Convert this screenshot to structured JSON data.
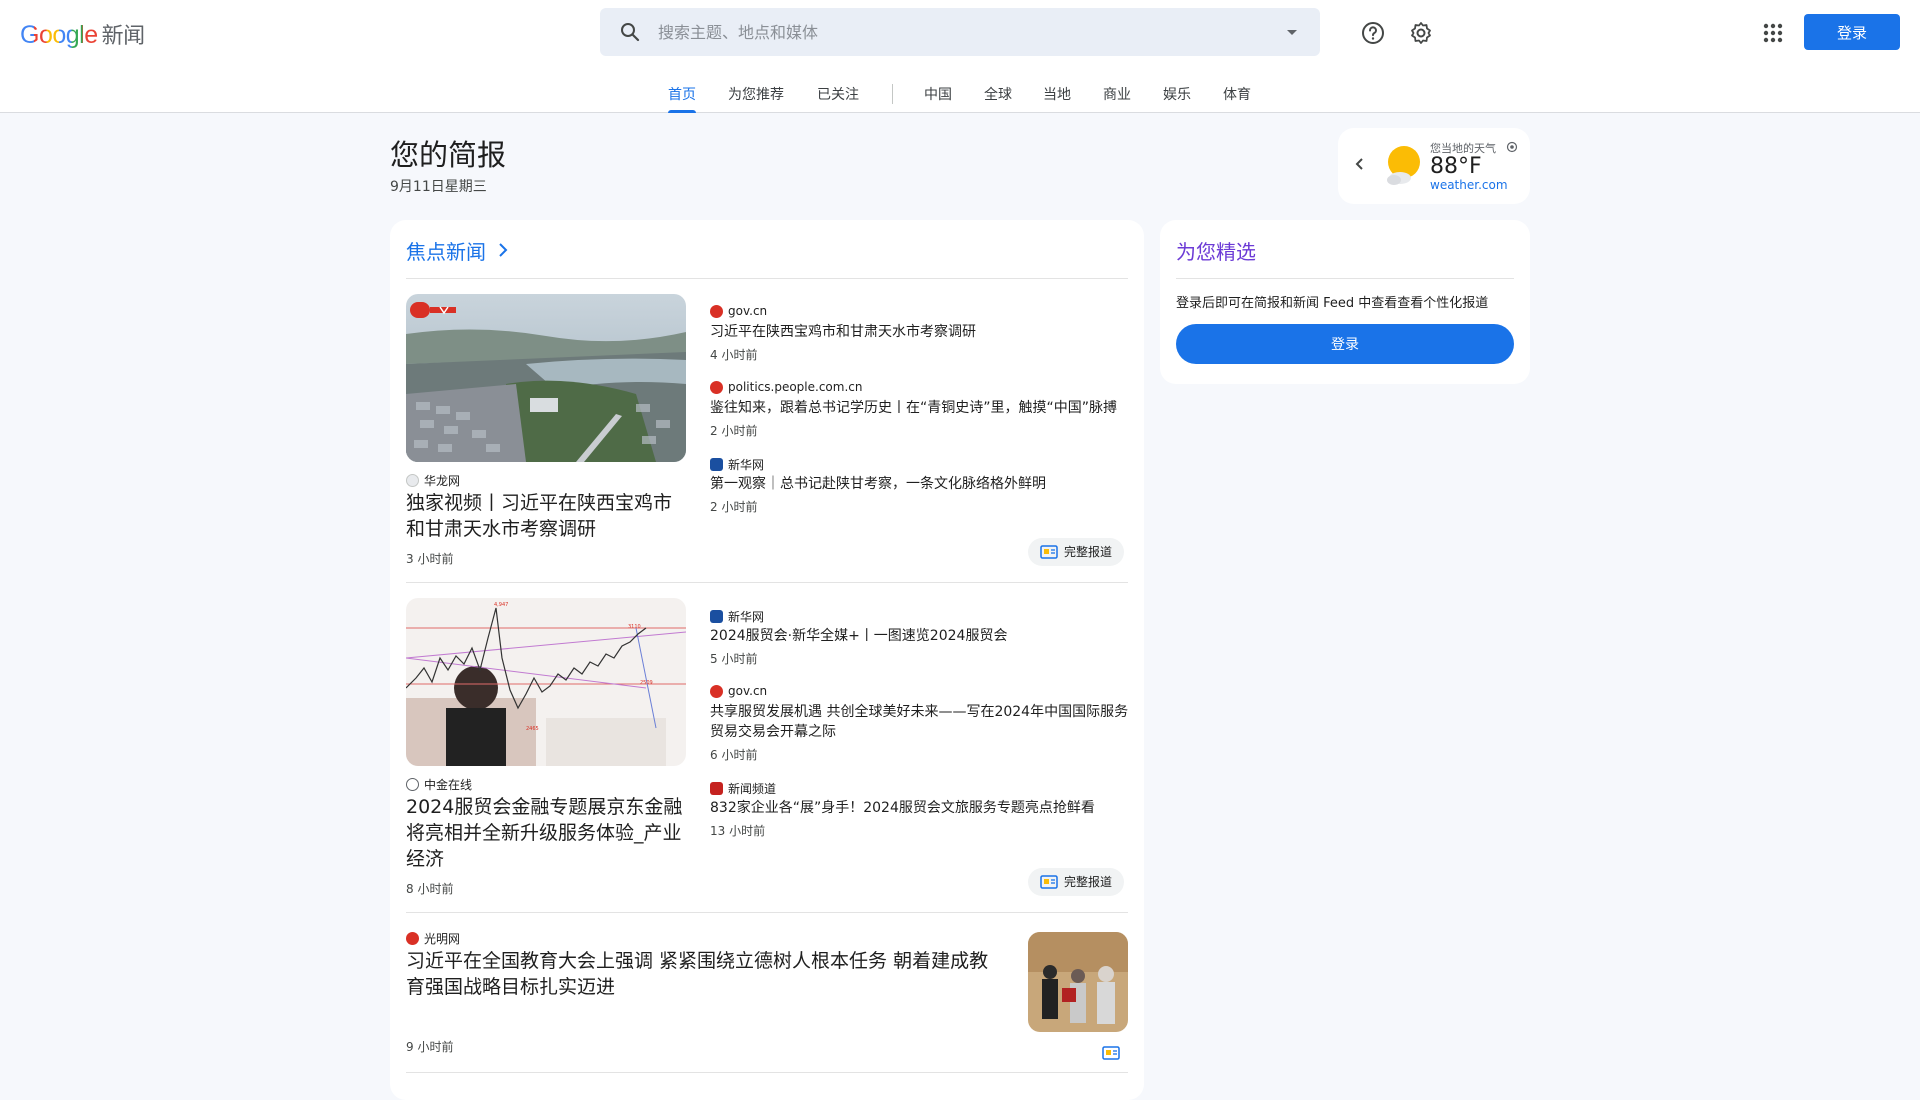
{
  "header": {
    "logo_brand": "Google",
    "logo_product": "新闻",
    "search_placeholder": "搜索主题、地点和媒体",
    "signin_label": "登录"
  },
  "nav": {
    "items": [
      "首页",
      "为您推荐",
      "已关注",
      "中国",
      "全球",
      "当地",
      "商业",
      "娱乐",
      "体育"
    ]
  },
  "briefing": {
    "title": "您的简报",
    "date": "9月11日星期三"
  },
  "weather": {
    "label": "您当地的天气",
    "temp": "88°F",
    "source": "weather.com"
  },
  "top_stories": {
    "title": "焦点新闻",
    "full_coverage_label": "完整报道",
    "clusters": [
      {
        "main": {
          "source": "华龙网",
          "headline": "独家视频丨习近平在陕西宝鸡市和甘肃天水市考察调研",
          "time": "3 小时前",
          "image_badge": "央视 · 时政"
        },
        "subs": [
          {
            "source": "gov.cn",
            "headline": "习近平在陕西宝鸡市和甘肃天水市考察调研",
            "time": "4 小时前"
          },
          {
            "source": "politics.people.com.cn",
            "headline": "鉴往知来，跟着总书记学历史丨在“青铜史诗”里，触摸“中国”脉搏",
            "time": "2 小时前"
          },
          {
            "source": "新华网",
            "headline": "第一观察｜总书记赴陕甘考察，一条文化脉络格外鲜明",
            "time": "2 小时前"
          }
        ]
      },
      {
        "main": {
          "source": "中金在线",
          "headline": "2024服贸会金融专题展京东金融将亮相并全新升级服务体验_产业经济",
          "time": "8 小时前"
        },
        "subs": [
          {
            "source": "新华网",
            "headline": "2024服贸会·新华全媒+丨一图速览2024服贸会",
            "time": "5 小时前"
          },
          {
            "source": "gov.cn",
            "headline": "共享服贸发展机遇 共创全球美好未来——写在2024年中国国际服务贸易交易会开幕之际",
            "time": "6 小时前"
          },
          {
            "source": "新闻频道",
            "headline": "832家企业各“展”身手！2024服贸会文旅服务专题亮点抢鲜看",
            "time": "13 小时前"
          }
        ]
      },
      {
        "main": {
          "source": "光明网",
          "headline": "习近平在全国教育大会上强调 紧紧围绕立德树人根本任务 朝着建成教育强国战略目标扎实迈进",
          "time": "9 小时前"
        }
      }
    ]
  },
  "picks": {
    "title": "为您精选",
    "message": "登录后即可在简报和新闻 Feed 中查看查看个性化报道",
    "button": "登录"
  },
  "colors": {
    "accent": "#1a73e8",
    "picks_title": "#6c3bd6",
    "background": "#f6f8fc"
  }
}
